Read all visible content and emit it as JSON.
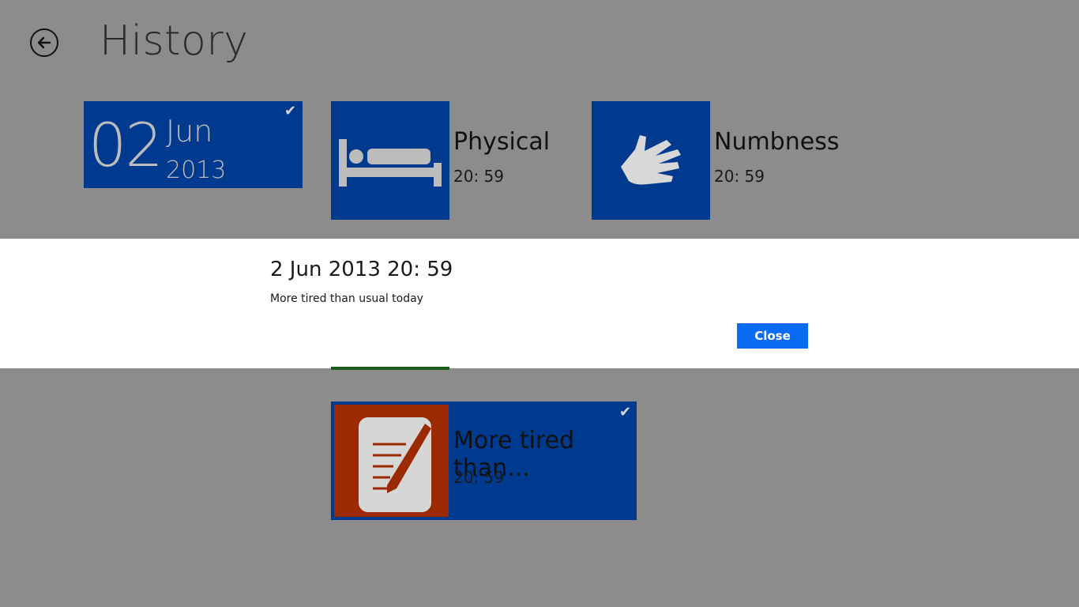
{
  "header": {
    "title": "History",
    "back_icon": "back-arrow-icon"
  },
  "date_group": {
    "day": "02",
    "month": "Jun",
    "year": "2013",
    "selected": true
  },
  "entries": [
    {
      "title": "Physical",
      "time": "20: 59",
      "icon": "bed-icon",
      "color": "#003a8f"
    },
    {
      "title": "Numbness",
      "time": "20: 59",
      "icon": "hand-icon",
      "color": "#003a8f"
    },
    {
      "title": "More tired than...",
      "time": "20: 59",
      "icon": "note-pencil-icon",
      "color": "#9b2a00",
      "selected": true
    }
  ],
  "dialog": {
    "title": "2 Jun 2013 20: 59",
    "message": "More tired than usual today",
    "close_label": "Close"
  },
  "colors": {
    "background": "#8c8c8c",
    "tile": "#003a8f",
    "accent_button": "#0a6cf5",
    "note_tile": "#9b2a00"
  }
}
